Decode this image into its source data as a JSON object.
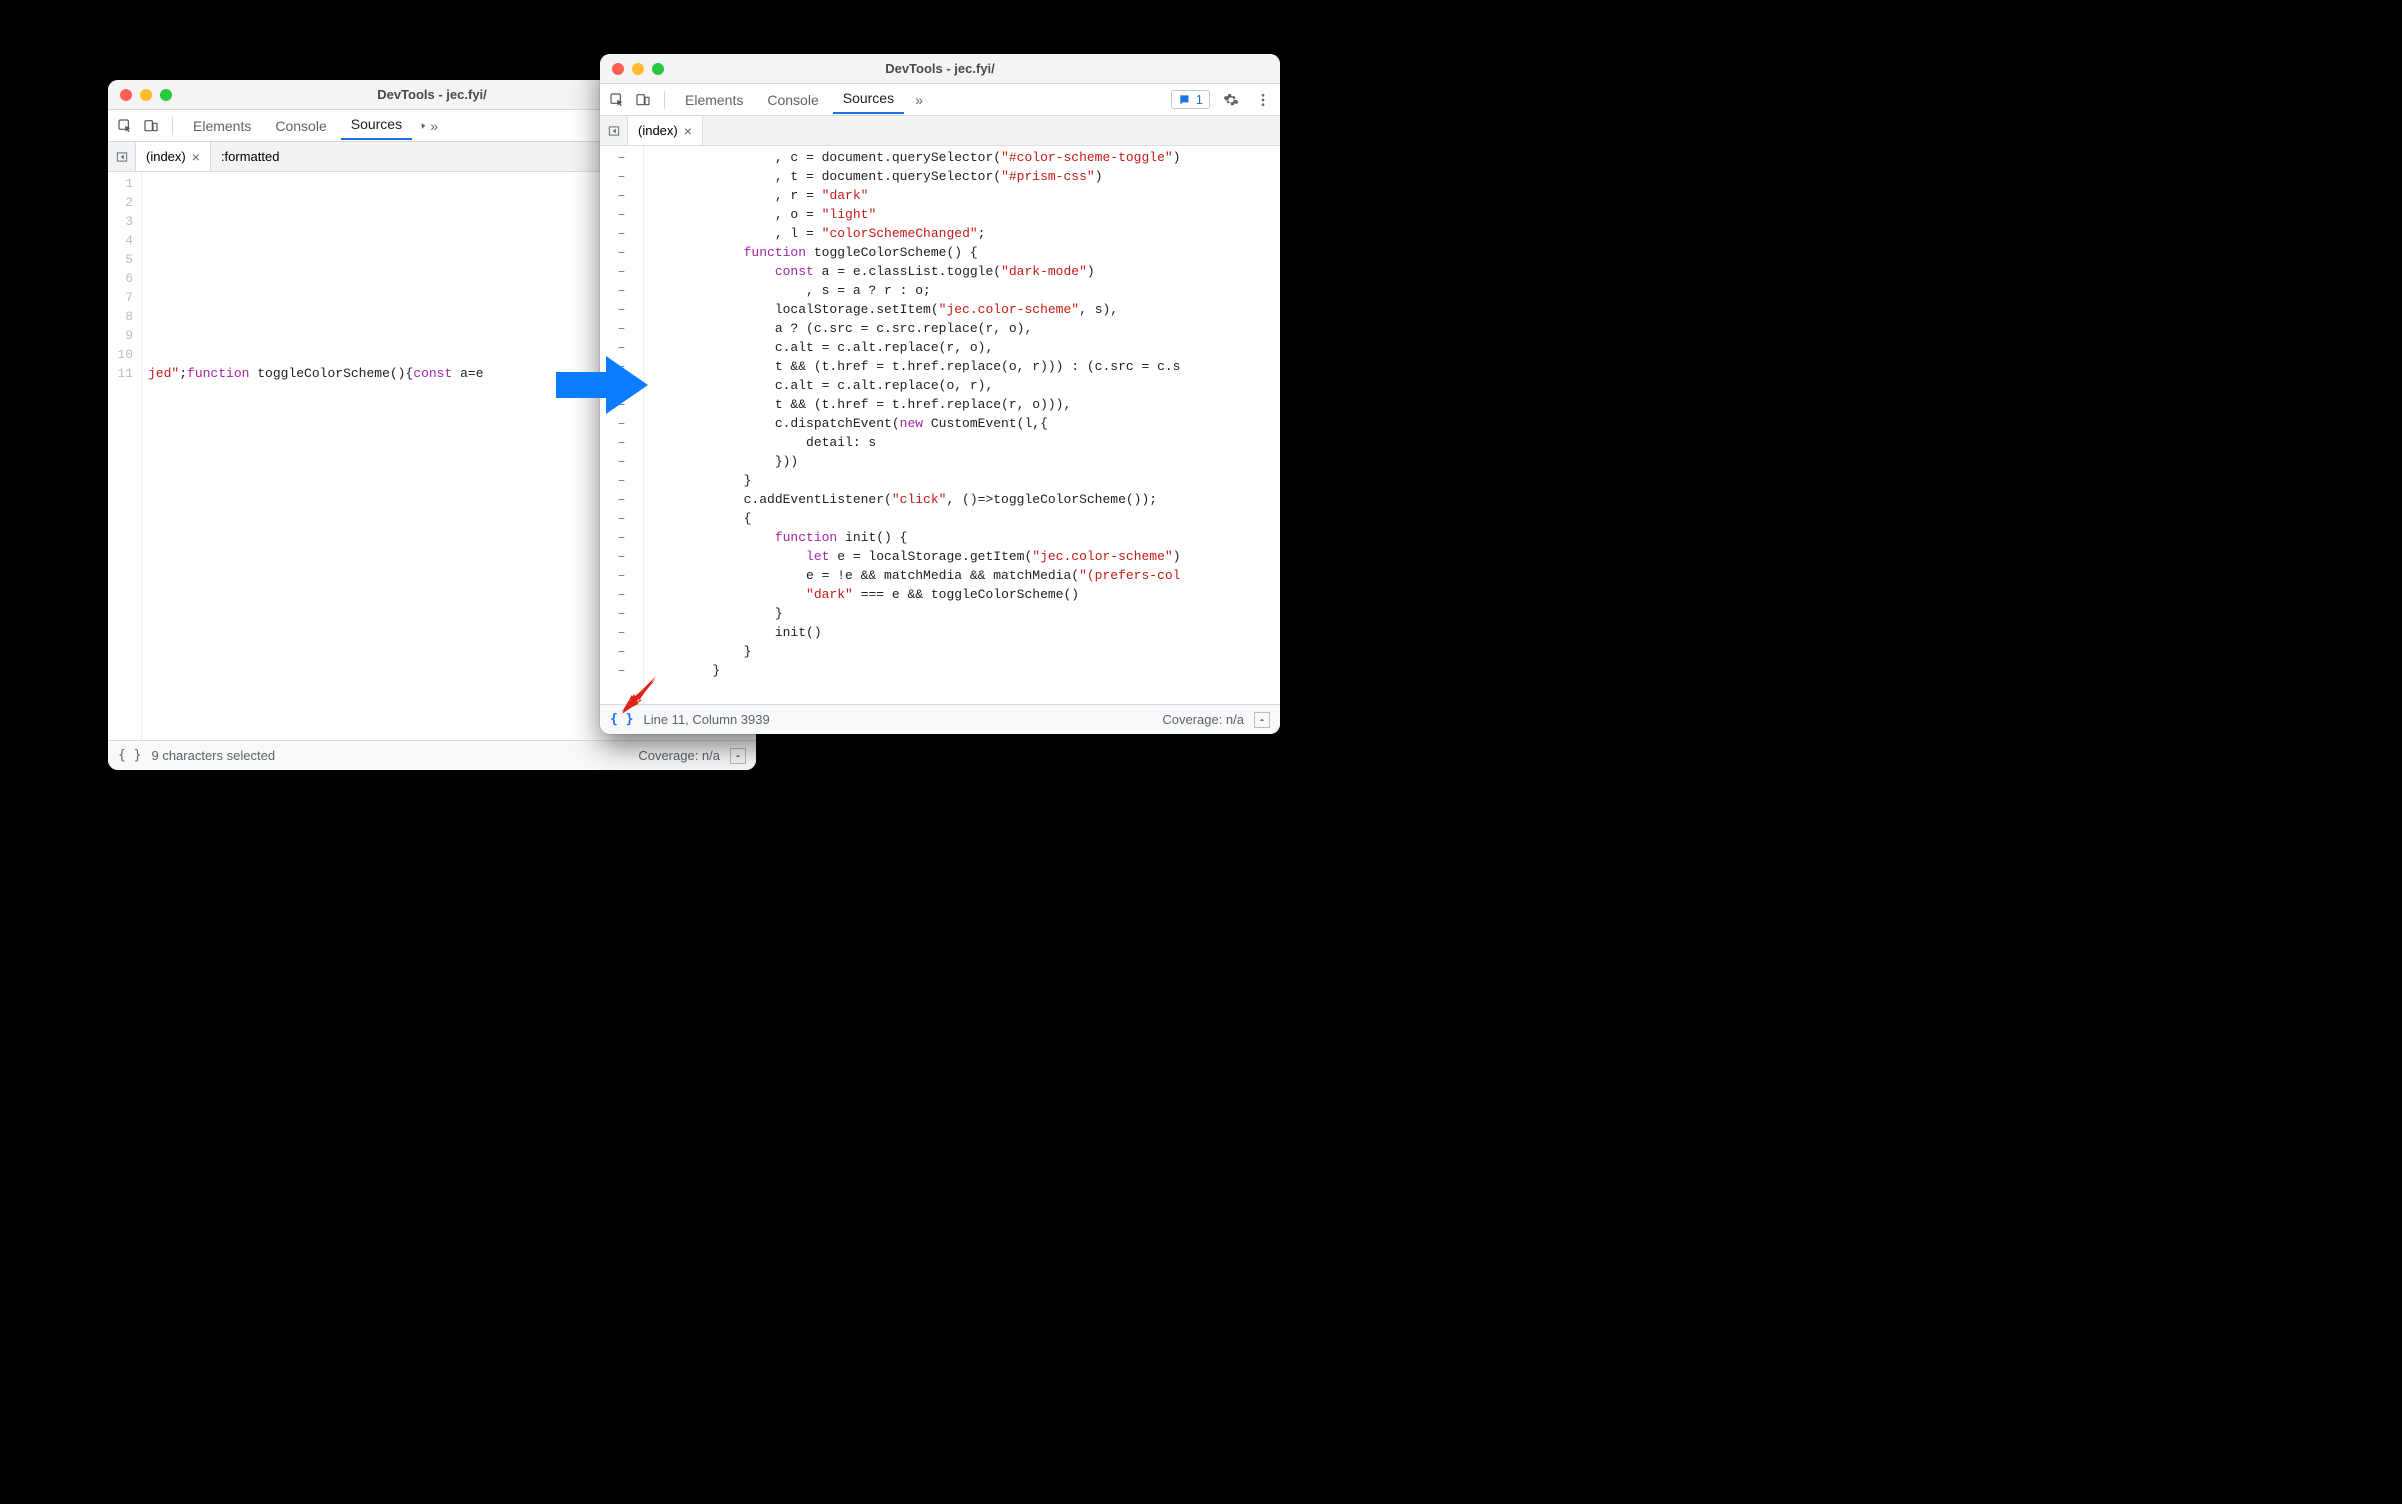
{
  "left_window": {
    "title": "DevTools - jec.fyi/",
    "tabs": {
      "elements": "Elements",
      "console": "Console",
      "sources": "Sources"
    },
    "file_tabs": {
      "index": "(index)",
      "formatted": ":formatted"
    },
    "gutter_lines": [
      "1",
      "2",
      "3",
      "4",
      "5",
      "6",
      "7",
      "8",
      "9",
      "10",
      "11"
    ],
    "code_line11_part1": "jed\"",
    "code_line11_semicolon": ";",
    "code_line11_kw_function": "function",
    "code_line11_fname": " toggleColorScheme(){",
    "code_line11_kw_const": "const",
    "code_line11_rest": " a=e",
    "status_left": "9 characters selected",
    "status_coverage": "Coverage: n/a",
    "pretty_print": "{ }"
  },
  "right_window": {
    "title": "DevTools - jec.fyi/",
    "tabs": {
      "elements": "Elements",
      "console": "Console",
      "sources": "Sources"
    },
    "issues_count": "1",
    "file_tabs": {
      "index": "(index)"
    },
    "code_lines": [
      {
        "indent": 4,
        "segs": [
          {
            "t": ", c = document.querySelector("
          },
          {
            "c": "str",
            "t": "\"#color-scheme-toggle\""
          },
          {
            "t": ")"
          }
        ]
      },
      {
        "indent": 4,
        "segs": [
          {
            "t": ", t = document.querySelector("
          },
          {
            "c": "str",
            "t": "\"#prism-css\""
          },
          {
            "t": ")"
          }
        ]
      },
      {
        "indent": 4,
        "segs": [
          {
            "t": ", r = "
          },
          {
            "c": "str",
            "t": "\"dark\""
          }
        ]
      },
      {
        "indent": 4,
        "segs": [
          {
            "t": ", o = "
          },
          {
            "c": "str",
            "t": "\"light\""
          }
        ]
      },
      {
        "indent": 4,
        "segs": [
          {
            "t": ", l = "
          },
          {
            "c": "str",
            "t": "\"colorSchemeChanged\""
          },
          {
            "t": ";"
          }
        ]
      },
      {
        "indent": 3,
        "segs": [
          {
            "c": "kw",
            "t": "function"
          },
          {
            "t": " toggleColorScheme() {"
          }
        ]
      },
      {
        "indent": 4,
        "segs": [
          {
            "c": "kw",
            "t": "const"
          },
          {
            "t": " a = e.classList.toggle("
          },
          {
            "c": "str",
            "t": "\"dark-mode\""
          },
          {
            "t": ")"
          }
        ]
      },
      {
        "indent": 5,
        "segs": [
          {
            "t": ", s = a ? r : o;"
          }
        ]
      },
      {
        "indent": 4,
        "segs": [
          {
            "t": "localStorage.setItem("
          },
          {
            "c": "str",
            "t": "\"jec.color-scheme\""
          },
          {
            "t": ", s),"
          }
        ]
      },
      {
        "indent": 4,
        "segs": [
          {
            "t": "a ? (c.src = c.src.replace(r, o),"
          }
        ]
      },
      {
        "indent": 4,
        "segs": [
          {
            "t": "c.alt = c.alt.replace(r, o),"
          }
        ]
      },
      {
        "indent": 4,
        "segs": [
          {
            "t": "t && (t.href = t.href.replace(o, r))) : (c.src = c.s"
          }
        ]
      },
      {
        "indent": 4,
        "segs": [
          {
            "t": "c.alt = c.alt.replace(o, r),"
          }
        ]
      },
      {
        "indent": 4,
        "segs": [
          {
            "t": "t && (t.href = t.href.replace(r, o))),"
          }
        ]
      },
      {
        "indent": 4,
        "segs": [
          {
            "t": "c.dispatchEvent("
          },
          {
            "c": "kw",
            "t": "new"
          },
          {
            "t": " CustomEvent(l,{"
          }
        ]
      },
      {
        "indent": 5,
        "segs": [
          {
            "t": "detail: s"
          }
        ]
      },
      {
        "indent": 4,
        "segs": [
          {
            "t": "}))"
          }
        ]
      },
      {
        "indent": 3,
        "segs": [
          {
            "t": "}"
          }
        ]
      },
      {
        "indent": 3,
        "segs": [
          {
            "t": "c.addEventListener("
          },
          {
            "c": "str",
            "t": "\"click\""
          },
          {
            "t": ", ()=>toggleColorScheme());"
          }
        ]
      },
      {
        "indent": 3,
        "segs": [
          {
            "t": "{"
          }
        ]
      },
      {
        "indent": 4,
        "segs": [
          {
            "c": "kw",
            "t": "function"
          },
          {
            "t": " init() {"
          }
        ]
      },
      {
        "indent": 5,
        "segs": [
          {
            "c": "kw",
            "t": "let"
          },
          {
            "t": " e = localStorage.getItem("
          },
          {
            "c": "str",
            "t": "\"jec.color-scheme\""
          },
          {
            "t": ")"
          }
        ]
      },
      {
        "indent": 5,
        "segs": [
          {
            "t": "e = !e && matchMedia && matchMedia("
          },
          {
            "c": "str",
            "t": "\"(prefers-col"
          }
        ]
      },
      {
        "indent": 5,
        "segs": [
          {
            "c": "str",
            "t": "\"dark\""
          },
          {
            "t": " === e && toggleColorScheme()"
          }
        ]
      },
      {
        "indent": 4,
        "segs": [
          {
            "t": "}"
          }
        ]
      },
      {
        "indent": 4,
        "segs": [
          {
            "t": "init()"
          }
        ]
      },
      {
        "indent": 3,
        "segs": [
          {
            "t": "}"
          }
        ]
      },
      {
        "indent": 2,
        "segs": [
          {
            "t": "}"
          }
        ]
      }
    ],
    "status_left": "Line 11, Column 3939",
    "status_coverage": "Coverage: n/a",
    "pretty_print": "{ }"
  }
}
